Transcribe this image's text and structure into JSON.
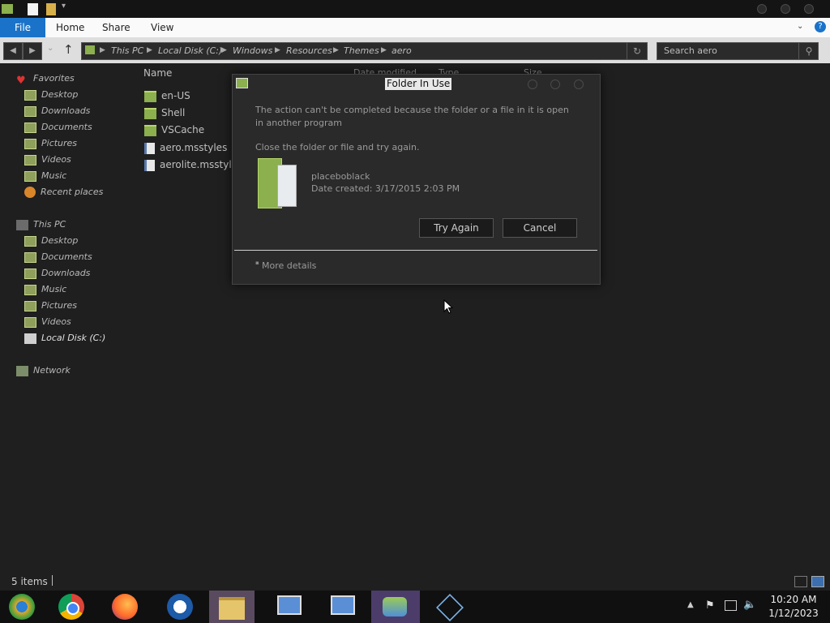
{
  "ribbon": {
    "tabs": [
      "File",
      "Home",
      "Share",
      "View"
    ]
  },
  "address": {
    "crumbs": [
      "This PC",
      "Local Disk (C:)",
      "Windows",
      "Resources",
      "Themes",
      "aero"
    ]
  },
  "search": {
    "placeholder": "Search aero"
  },
  "columns": {
    "name": "Name",
    "date_modified": "Date modified",
    "type": "Type",
    "size": "Size"
  },
  "nav": {
    "favorites_header": "Favorites",
    "favorites": [
      "Desktop",
      "Downloads",
      "Documents",
      "Pictures",
      "Videos",
      "Music",
      "Recent places"
    ],
    "thispc_header": "This PC",
    "thispc": [
      "Desktop",
      "Documents",
      "Downloads",
      "Music",
      "Pictures",
      "Videos",
      "Local Disk (C:)"
    ],
    "network": "Network"
  },
  "files": [
    "en-US",
    "Shell",
    "VSCache",
    "aero.msstyles",
    "aerolite.msstyles"
  ],
  "dialog": {
    "title": "Folder In Use",
    "message": "The action can't be completed because the folder or a file in it is open in another program",
    "instruction": "Close the folder or file and try again.",
    "item_name": "placeboblack",
    "item_date": "Date created: 3/17/2015 2:03 PM",
    "try_again": "Try Again",
    "cancel": "Cancel",
    "more_details": "More details"
  },
  "status": {
    "count": "5 items"
  },
  "clock": {
    "time": "10:20 AM",
    "date": "1/12/2023"
  },
  "colors": {
    "file_tab": "#1a73c9",
    "folder_green": "#8bb04d"
  }
}
